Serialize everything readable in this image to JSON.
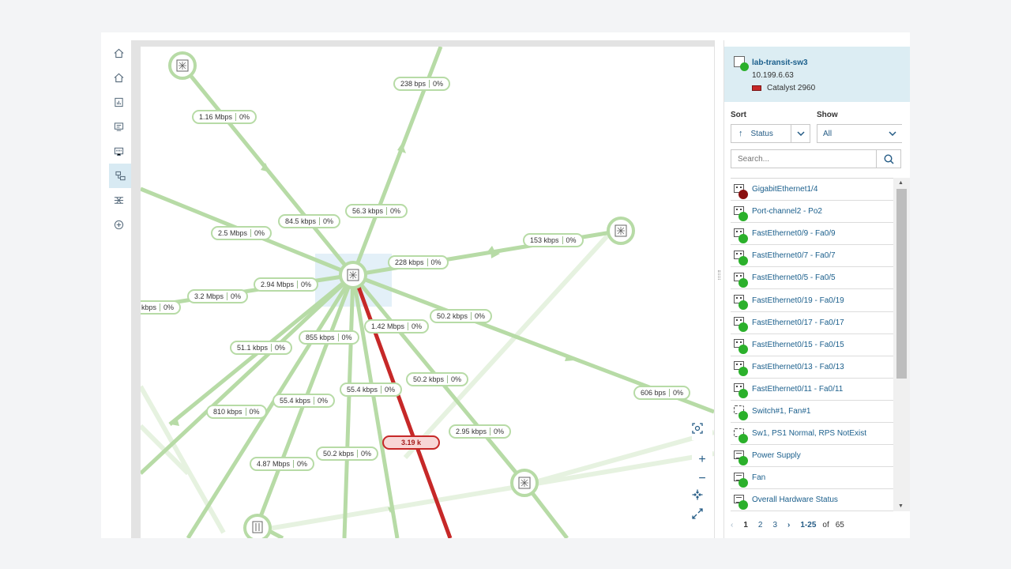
{
  "nav": {
    "items": [
      {
        "name": "home",
        "icon": "home-icon"
      },
      {
        "name": "home-2",
        "icon": "home-icon"
      },
      {
        "name": "reports",
        "icon": "report-icon"
      },
      {
        "name": "alerts",
        "icon": "alert-monitor-icon"
      },
      {
        "name": "ports",
        "icon": "port-icon"
      },
      {
        "name": "topology",
        "icon": "topology-icon",
        "active": true
      },
      {
        "name": "network",
        "icon": "network-icon"
      },
      {
        "name": "add",
        "icon": "add-icon"
      }
    ]
  },
  "map": {
    "links": [
      {
        "id": "l1",
        "text": "1.16 Mbps",
        "pct": "0%"
      },
      {
        "id": "l2",
        "text": "238 bps",
        "pct": "0%"
      },
      {
        "id": "l3",
        "text": "84.5 kbps",
        "pct": "0%"
      },
      {
        "id": "l4",
        "text": "56.3 kbps",
        "pct": "0%"
      },
      {
        "id": "l5",
        "text": "2.5 Mbps",
        "pct": "0%"
      },
      {
        "id": "l6",
        "text": "153 kbps",
        "pct": "0%"
      },
      {
        "id": "l7",
        "text": "228 kbps",
        "pct": "0%"
      },
      {
        "id": "l8",
        "text": "2.94 Mbps",
        "pct": "0%"
      },
      {
        "id": "l9",
        "text": "3.2 Mbps",
        "pct": "0%"
      },
      {
        "id": "l10",
        "text": "kbps",
        "pct": "0%"
      },
      {
        "id": "l11",
        "text": "50.2 kbps",
        "pct": "0%"
      },
      {
        "id": "l12",
        "text": "1.42 Mbps",
        "pct": "0%"
      },
      {
        "id": "l13",
        "text": "855 kbps",
        "pct": "0%"
      },
      {
        "id": "l14",
        "text": "51.1 kbps",
        "pct": "0%"
      },
      {
        "id": "l15",
        "text": "50.2 kbps",
        "pct": "0%"
      },
      {
        "id": "l16",
        "text": "55.4 kbps",
        "pct": "0%"
      },
      {
        "id": "l17",
        "text": "55.4 kbps",
        "pct": "0%"
      },
      {
        "id": "l18",
        "text": "810 kbps",
        "pct": "0%"
      },
      {
        "id": "l19",
        "text": "606 bps",
        "pct": "0%"
      },
      {
        "id": "l20",
        "text": "2.95 kbps",
        "pct": "0%"
      },
      {
        "id": "l21",
        "text": "4.87 Mbps",
        "pct": "0%"
      },
      {
        "id": "l22",
        "text": "50.2 kbps",
        "pct": "0%"
      }
    ],
    "alert_link": {
      "text": "3.19 k"
    },
    "controls": [
      {
        "name": "fit-selection",
        "icon": "fit-icon"
      },
      {
        "name": "zoom-in",
        "icon": "plus-icon",
        "glyph": "+"
      },
      {
        "name": "zoom-out",
        "icon": "minus-icon",
        "glyph": "−"
      },
      {
        "name": "center",
        "icon": "collapse-icon"
      },
      {
        "name": "expand",
        "icon": "expand-icon"
      }
    ]
  },
  "device": {
    "name": "lab-transit-sw3",
    "ip": "10.199.6.63",
    "model": "Catalyst 2960",
    "status_color": "#2bb02b"
  },
  "controls": {
    "sort_label": "Sort",
    "sort_value": "Status",
    "show_label": "Show",
    "show_value": "All",
    "search_placeholder": "Search..."
  },
  "list": {
    "items": [
      {
        "label": "GigabitEthernet1/4",
        "icon": "port-icon",
        "status": "down"
      },
      {
        "label": "Port-channel2 - Po2",
        "icon": "port-icon",
        "status": "up"
      },
      {
        "label": "FastEthernet0/9 - Fa0/9",
        "icon": "port-icon",
        "status": "up"
      },
      {
        "label": "FastEthernet0/7 - Fa0/7",
        "icon": "port-icon",
        "status": "up"
      },
      {
        "label": "FastEthernet0/5 - Fa0/5",
        "icon": "port-icon",
        "status": "up"
      },
      {
        "label": "FastEthernet0/19 - Fa0/19",
        "icon": "port-icon",
        "status": "up"
      },
      {
        "label": "FastEthernet0/17 - Fa0/17",
        "icon": "port-icon",
        "status": "up"
      },
      {
        "label": "FastEthernet0/15 - Fa0/15",
        "icon": "port-icon",
        "status": "up"
      },
      {
        "label": "FastEthernet0/13 - Fa0/13",
        "icon": "port-icon",
        "status": "up"
      },
      {
        "label": "FastEthernet0/11 - Fa0/11",
        "icon": "port-icon",
        "status": "up"
      },
      {
        "label": "Switch#1, Fan#1",
        "icon": "hardware-icon",
        "status": "up"
      },
      {
        "label": "Sw1, PS1 Normal, RPS NotExist",
        "icon": "hardware-icon",
        "status": "up"
      },
      {
        "label": "Power Supply",
        "icon": "document-icon",
        "status": "up"
      },
      {
        "label": "Fan",
        "icon": "document-icon",
        "status": "up"
      },
      {
        "label": "Overall Hardware Status",
        "icon": "document-icon",
        "status": "up"
      }
    ]
  },
  "pager": {
    "pages": [
      "1",
      "2",
      "3"
    ],
    "current": "1",
    "range": "1-25",
    "of": "of",
    "total": "65"
  },
  "colors": {
    "link": "#b7dba6",
    "link_faint": "#e6f2e0",
    "link_alert": "#c62828",
    "accent": "#1b5f8c",
    "up": "#2bb02b",
    "down": "#8a0f0f"
  }
}
